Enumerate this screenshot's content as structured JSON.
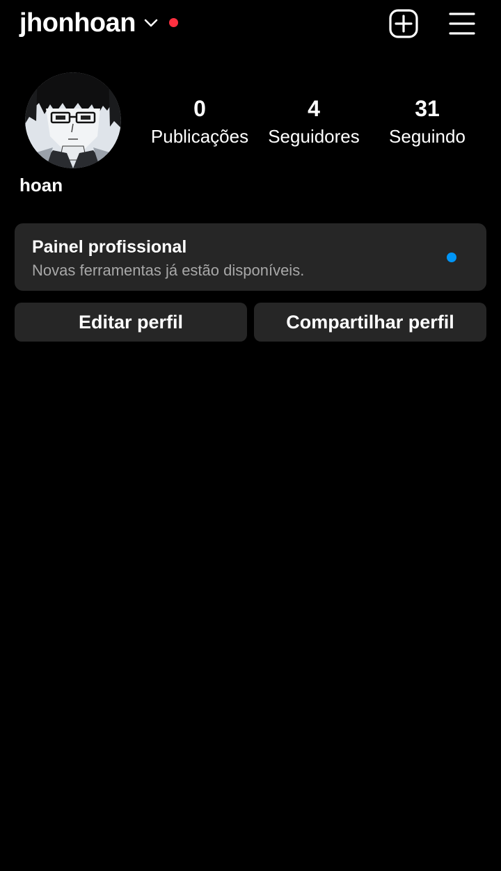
{
  "colors": {
    "background": "#000000",
    "text": "#ffffff",
    "secondary_text": "#a8a8a8",
    "surface": "#262626",
    "notification_dot": "#ff3040",
    "accent_dot": "#0095f6"
  },
  "header": {
    "username": "jhonhoan",
    "username_chevron_icon": "chevron-down-icon",
    "notification_indicator": "red-dot",
    "create_icon": "plus-square-icon",
    "menu_icon": "hamburger-menu-icon"
  },
  "profile": {
    "avatar_icon": "profile-picture",
    "display_name": "hoan",
    "stats": {
      "posts": {
        "value": "0",
        "label": "Publicações"
      },
      "followers": {
        "value": "4",
        "label": "Seguidores"
      },
      "following": {
        "value": "31",
        "label": "Seguindo"
      }
    }
  },
  "professional_dashboard": {
    "title": "Painel profissional",
    "subtitle": "Novas ferramentas já estão disponíveis.",
    "indicator": "blue-dot"
  },
  "actions": {
    "edit_label": "Editar perfil",
    "share_label": "Compartilhar perfil"
  }
}
